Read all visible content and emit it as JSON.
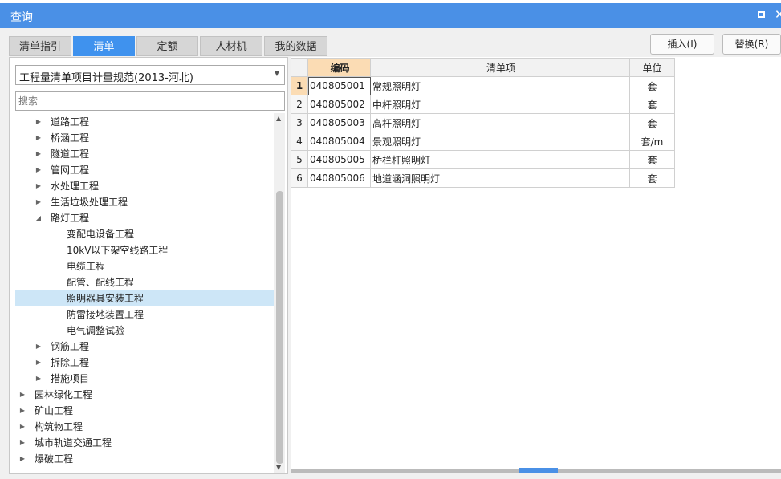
{
  "window": {
    "title": "查询"
  },
  "tabs": [
    "清单指引",
    "清单",
    "定额",
    "人材机",
    "我的数据"
  ],
  "active_tab": "清单",
  "buttons": {
    "insert": "插入(I)",
    "replace": "替换(R)"
  },
  "spec_select": {
    "value": "工程量清单项目计量规范(2013-河北)"
  },
  "search": {
    "placeholder": "搜索"
  },
  "tree": [
    {
      "label": "道路工程",
      "level": 1,
      "state": "collapsed"
    },
    {
      "label": "桥涵工程",
      "level": 1,
      "state": "collapsed"
    },
    {
      "label": "隧道工程",
      "level": 1,
      "state": "collapsed"
    },
    {
      "label": "管网工程",
      "level": 1,
      "state": "collapsed"
    },
    {
      "label": "水处理工程",
      "level": 1,
      "state": "collapsed"
    },
    {
      "label": "生活垃圾处理工程",
      "level": 1,
      "state": "collapsed"
    },
    {
      "label": "路灯工程",
      "level": 1,
      "state": "expanded"
    },
    {
      "label": "变配电设备工程",
      "level": 2,
      "state": "leaf"
    },
    {
      "label": "10kV以下架空线路工程",
      "level": 2,
      "state": "leaf"
    },
    {
      "label": "电缆工程",
      "level": 2,
      "state": "leaf"
    },
    {
      "label": "配管、配线工程",
      "level": 2,
      "state": "leaf"
    },
    {
      "label": "照明器具安装工程",
      "level": 2,
      "state": "leaf",
      "selected": true
    },
    {
      "label": "防雷接地装置工程",
      "level": 2,
      "state": "leaf"
    },
    {
      "label": "电气调整试验",
      "level": 2,
      "state": "leaf"
    },
    {
      "label": "钢筋工程",
      "level": 1,
      "state": "collapsed"
    },
    {
      "label": "拆除工程",
      "level": 1,
      "state": "collapsed"
    },
    {
      "label": "措施项目",
      "level": 1,
      "state": "collapsed"
    },
    {
      "label": "园林绿化工程",
      "level": 0,
      "state": "collapsed"
    },
    {
      "label": "矿山工程",
      "level": 0,
      "state": "collapsed"
    },
    {
      "label": "构筑物工程",
      "level": 0,
      "state": "collapsed"
    },
    {
      "label": "城市轨道交通工程",
      "level": 0,
      "state": "collapsed"
    },
    {
      "label": "爆破工程",
      "level": 0,
      "state": "collapsed"
    }
  ],
  "grid": {
    "headers": {
      "code": "编码",
      "name": "清单项",
      "unit": "单位"
    },
    "rows": [
      {
        "num": "1",
        "code": "040805001",
        "name": "常规照明灯",
        "unit": "套"
      },
      {
        "num": "2",
        "code": "040805002",
        "name": "中杆照明灯",
        "unit": "套"
      },
      {
        "num": "3",
        "code": "040805003",
        "name": "高杆照明灯",
        "unit": "套"
      },
      {
        "num": "4",
        "code": "040805004",
        "name": "景观照明灯",
        "unit": "套/m"
      },
      {
        "num": "5",
        "code": "040805005",
        "name": "桥栏杆照明灯",
        "unit": "套"
      },
      {
        "num": "6",
        "code": "040805006",
        "name": "地道涵洞照明灯",
        "unit": "套"
      }
    ]
  },
  "icons": {
    "maximize": "maximize-icon",
    "close": "close-icon",
    "dropdown": "chevron-down-icon"
  },
  "colors": {
    "accent": "#4a90e6",
    "selection": "#cde6f7",
    "header_highlight": "#fbdcb4"
  }
}
